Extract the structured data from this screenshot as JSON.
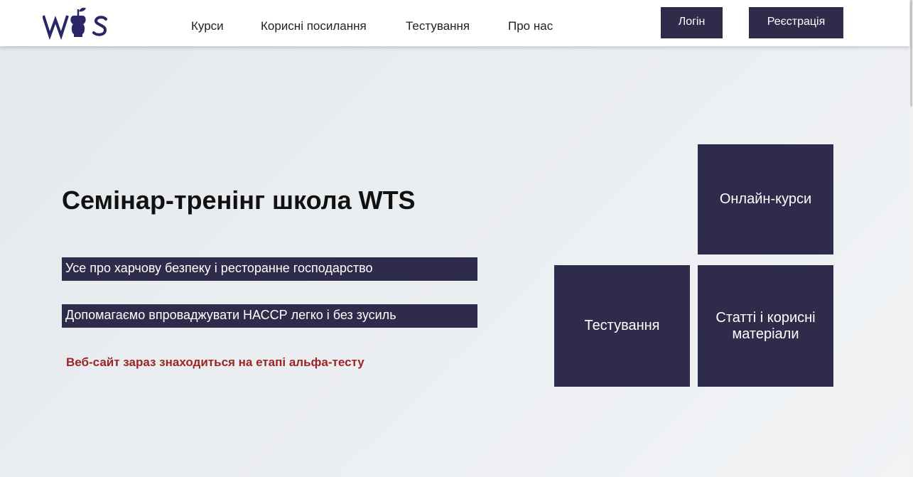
{
  "header": {
    "logo_text": "WTS",
    "nav": [
      {
        "label": "Курси"
      },
      {
        "label": "Корисні посилання"
      },
      {
        "label": "Тестування"
      },
      {
        "label": "Про нас"
      }
    ],
    "login_label": "Логін",
    "register_label": "Реєстрація"
  },
  "hero": {
    "title": "Семінар-тренінг школа WTS",
    "tagline_1": "Усе про харчову безпеку і ресторанне господарство",
    "tagline_2": "Допомагаємо впроваджувати НАССР легко і без зусиль",
    "alpha_notice": "Веб-сайт зараз знаходиться на етапі альфа-тесту"
  },
  "tiles": {
    "online_courses": "Онлайн-курси",
    "testing": "Тестування",
    "articles": "Статті і корисні матеріали"
  },
  "colors": {
    "primary": "#2e2b4b",
    "logo": "#2b2766",
    "alpha_text": "#9b2424",
    "background": "#e9ecef"
  }
}
